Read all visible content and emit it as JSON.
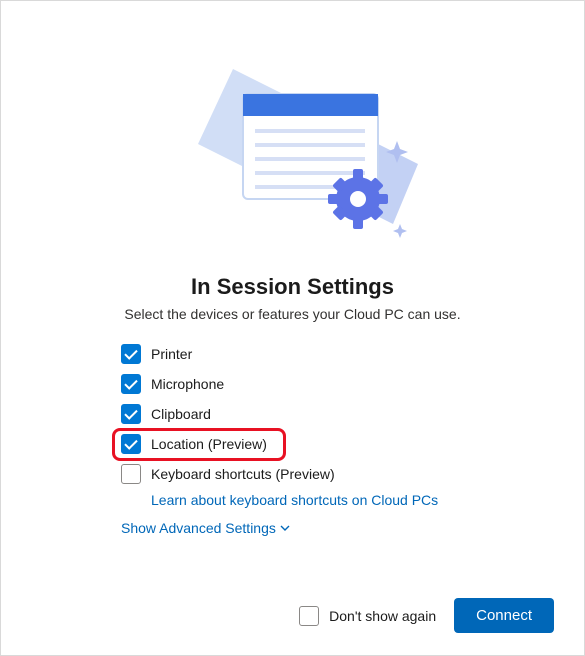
{
  "title": "In Session Settings",
  "subtitle": "Select the devices or features your Cloud PC can use.",
  "options": [
    {
      "label": "Printer",
      "checked": true,
      "highlight": false
    },
    {
      "label": "Microphone",
      "checked": true,
      "highlight": false
    },
    {
      "label": "Clipboard",
      "checked": true,
      "highlight": false
    },
    {
      "label": "Location (Preview)",
      "checked": true,
      "highlight": true
    },
    {
      "label": "Keyboard shortcuts (Preview)",
      "checked": false,
      "highlight": false,
      "sublink": "Learn about keyboard shortcuts on Cloud PCs"
    }
  ],
  "advanced_link": "Show Advanced Settings",
  "footer": {
    "dont_show": {
      "label": "Don't show again",
      "checked": false
    },
    "connect": "Connect"
  },
  "colors": {
    "accent": "#0078d4",
    "link": "#0067b8",
    "highlight": "#e81123"
  }
}
